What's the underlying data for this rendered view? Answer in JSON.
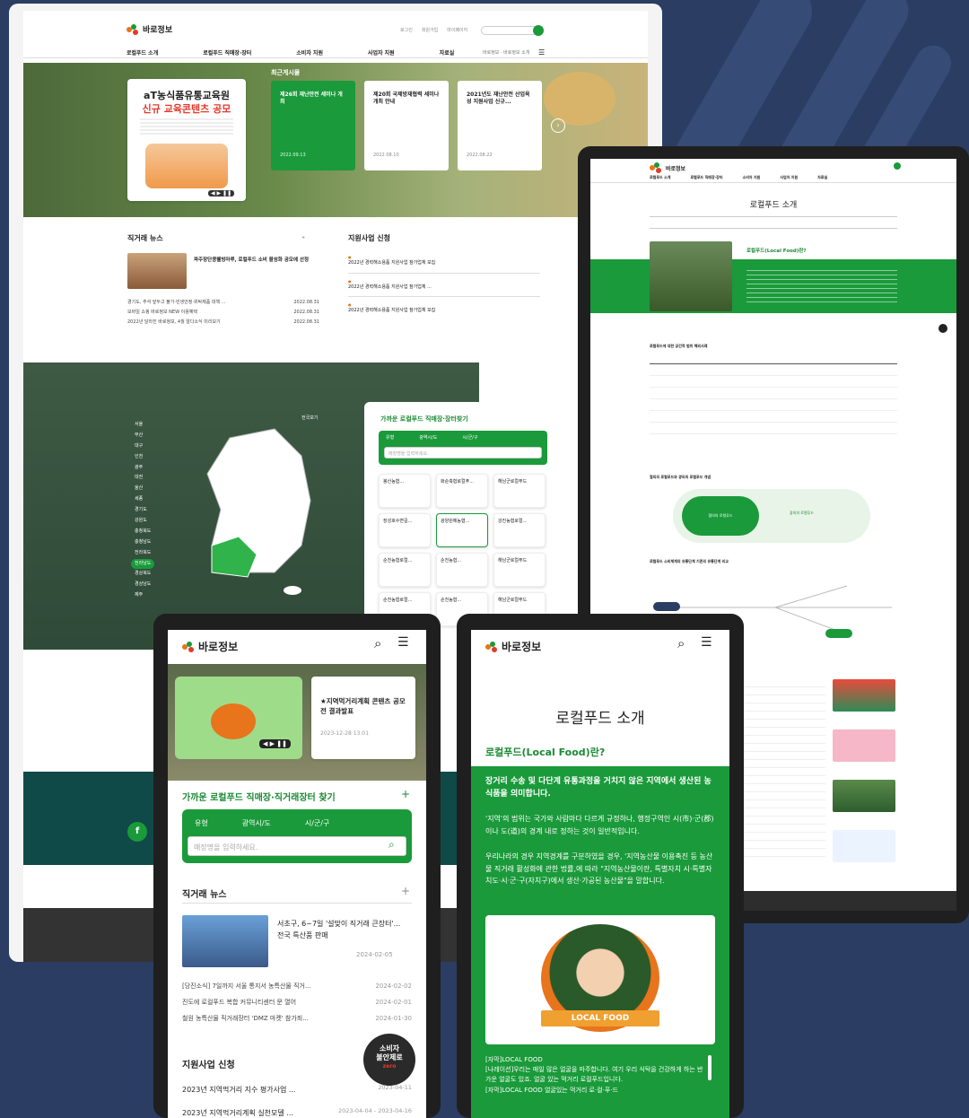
{
  "brand": {
    "name": "바로정보",
    "colors": {
      "green": "#1a9a3a",
      "bg": "#2b3d63",
      "orange": "#e8741c",
      "red": "#e23a2b"
    }
  },
  "desktop": {
    "util_links": [
      "로그인",
      "회원가입",
      "마이페이지"
    ],
    "nav": [
      "로컬푸드 소개",
      "로컬푸드 직매장·장터",
      "소비자 지원",
      "사업자 지원",
      "자료실"
    ],
    "nav_right": "바로정보 · 바로정보 소개",
    "banner": {
      "title": "aT농식품유통교육원",
      "subtitle": "신규 교육콘텐츠 공모"
    },
    "recent_label": "최근게시물",
    "recent_cards": [
      {
        "title": "제26회 재난안전 세미나 개최",
        "date": "2022.09.13"
      },
      {
        "title": "제20회 국제방재협력 세미나 개최 안내",
        "date": "2022.08.10"
      },
      {
        "title": "2021년도 재난안전 산업육성 지원사업 신규...",
        "date": "2022.08.22"
      }
    ],
    "news_title": "직거래 뉴스",
    "news_feature": "파주장단콩웰빙마루, 로컬푸드 소비 활성화 공모에 선정",
    "news_list": [
      {
        "text": "경기도, 추석 앞두고 불가·민생안정·위탁제품 대책 ...",
        "date": "2022.08.31"
      },
      {
        "text": "모바일 쇼핑 바로정보 NEW 이용혜택",
        "date": "2022.08.31"
      },
      {
        "text": "2022년 달라진 바로정보, 4월 알다소식 미리보기",
        "date": "2022.08.31"
      }
    ],
    "support_title": "지원사업 신청",
    "support_list": [
      "2022년 경력해소용품 지원사업 참가업체 모집",
      "2022년 경력해소용품 지원사업 참가업체 ...",
      "2022년 경력해소용품 지원사업 참가업체 모집"
    ],
    "map_regions": [
      "서울",
      "부산",
      "대구",
      "인천",
      "광주",
      "대전",
      "울산",
      "세종",
      "경기도",
      "강원도",
      "충청북도",
      "충청남도",
      "전라북도",
      "전라남도",
      "경상북도",
      "경상남도",
      "제주"
    ],
    "map_selected": "전라남도",
    "map_total": "전국보기",
    "finder_title": "가까운 로컬푸드 직매장·장터찾기",
    "finder_filters": [
      "유형",
      "광역시/도",
      "시/군/구"
    ],
    "finder_placeholder": "매장명을 입력하세요.",
    "shops": [
      "봉산농협...",
      "화순축협로컬푸...",
      "해남군로컬푸드",
      "장성호수변길...",
      "광양원예농협...",
      "강진농협로컬...",
      "순천농협로컬...",
      "순천농협...",
      "해남군로컬푸드",
      "순천농협로컬...",
      "순천농협...",
      "해남군로컬푸드"
    ]
  },
  "tablet": {
    "page_title": "로컬푸드 소개",
    "section_heading": "로컬푸드(Local Food)란?",
    "table_title": "로컬푸드에 대한 공간적 범위 해외사례",
    "diagram_title": "협의의 로컬푸드와 광의의 로컬푸드 개념",
    "diagram_labels": [
      "협의의 로컬푸드",
      "광의의 로컬푸드"
    ],
    "flow_title": "로컬푸드 소비체계의 유통단계 기존의 유통단계 비교"
  },
  "phone_left": {
    "brand": "바로정보",
    "banner_notice": "★지역먹거리계획 콘텐츠 공모전 결과발표",
    "banner_date": "2023-12-28 13:01",
    "finder_title": "가까운 로컬푸드 직매장·직거래장터 찾기",
    "filters": [
      "유형",
      "광역시/도",
      "시/군/구"
    ],
    "placeholder": "매장명을 입력하세요.",
    "news_title": "직거래 뉴스",
    "news_feature": "서초구, 6~7일 '설맞이 직거래 큰장터'...전국 특산품 판매",
    "news_feature_date": "2024-02-05",
    "news_list": [
      {
        "text": "[당진소식] 7일까지 서울 통지서 농특산물 직거...",
        "date": "2024-02-02"
      },
      {
        "text": "진도에 로컬푸드 복합 커뮤니티센터 문 열어",
        "date": "2024-02-01"
      },
      {
        "text": "철원 농특산물 직거래장터 'DMZ 마켓' 참가죄...",
        "date": "2024-01-30"
      }
    ],
    "support_title": "지원사업 신청",
    "support_list": [
      {
        "text": "2023년 지역먹거리 지수 평가사업 ...",
        "date": "2023-04-11"
      },
      {
        "text": "2023년 지역먹거리계획 실천모델 ...",
        "date": "2023-04-04 - 2023-04-16"
      }
    ],
    "badge": {
      "line1": "소비자",
      "line2": "불안제로",
      "line3": "zero"
    }
  },
  "phone_right": {
    "brand": "바로정보",
    "title": "로컬푸드 소개",
    "heading": "로컬푸드(Local Food)란?",
    "lead": "장거리 수송 및 다단계 유통과정을 거치지 않은 지역에서 생산된 농식품을 의미합니다.",
    "para1": "'지역'의 범위는 국가와 사람마다 다르게 규정하나, 행정구역인 시(市)·군(郡)이나 도(道)의 경계 내로 정하는 것이 일반적입니다.",
    "para2": "우리나라의 경우 지역경계를 구분하였을 경우, '지역농산물 이용촉진 등 농산물 직거래 활성화에 관한 법률,에 따라 \"지역농산물이란, 특별자치 시·특별자치도·시·군·구(자치구)에서 생산·가공된 농산물\"을 말합니다.",
    "badge": "LOCAL FOOD",
    "caption": [
      "[자막]LOCAL FOOD",
      "[나레이션]우리는 매일 많은 얼굴을 마주합니다. 여기 우리 식탁을 건강하게 하는 반가운 얼굴도 있죠. 얼굴 있는 먹거리 로컬푸드입니다.",
      "[자막]LOCAL FOOD 얼굴있는 먹거리 로·컬·푸·드"
    ]
  }
}
